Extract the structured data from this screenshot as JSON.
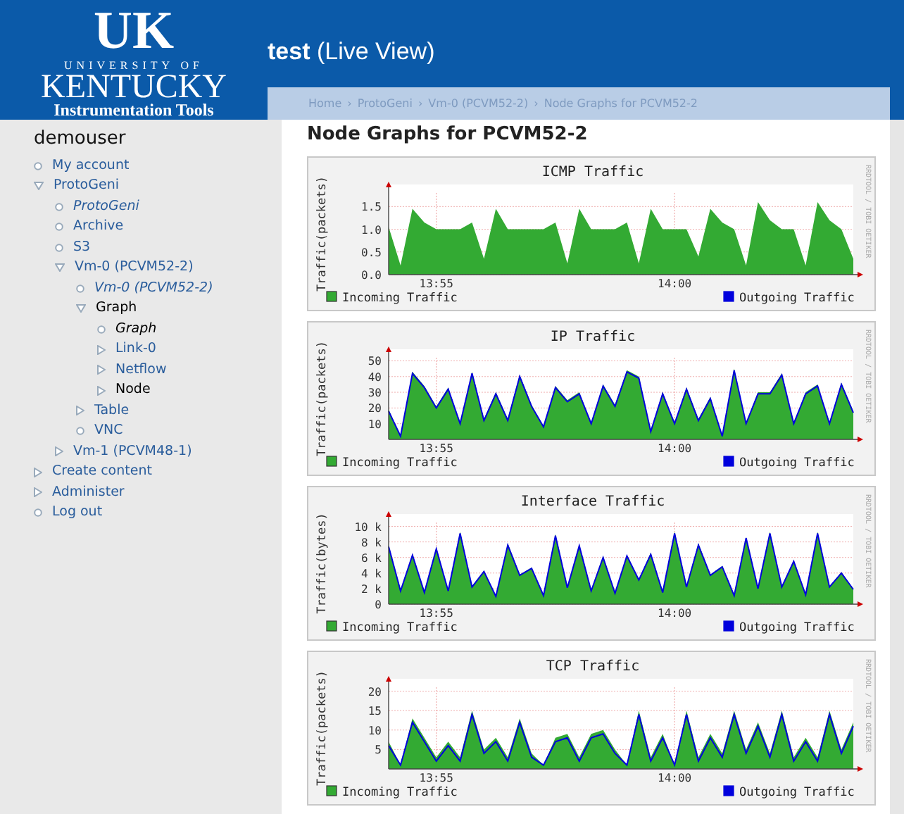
{
  "logo": {
    "mark": "UK",
    "line1": "UNIVERSITY OF",
    "line2": "KENTUCKY",
    "line3": "Instrumentation Tools"
  },
  "title": "**test** (Live View)",
  "breadcrumb": [
    {
      "label": "Home"
    },
    {
      "label": "ProtoGeni",
      "separator": "›"
    },
    {
      "label": "Vm-0 (PCVM52-2)",
      "separator": "›"
    },
    {
      "label": "Node Graphs for PCVM52-2",
      "separator": "›"
    }
  ],
  "sidebar": {
    "title": "demouser",
    "items": [
      {
        "label": "My account",
        "kind": "leaf",
        "italic": false,
        "active": false
      },
      {
        "label": "ProtoGeni",
        "kind": "expanded",
        "italic": false,
        "active": false,
        "children": [
          {
            "label": "ProtoGeni",
            "kind": "leaf",
            "italic": true,
            "active": false
          },
          {
            "label": "Archive",
            "kind": "leaf",
            "italic": false,
            "active": false
          },
          {
            "label": "S3",
            "kind": "leaf",
            "italic": false,
            "active": false
          },
          {
            "label": "Vm-0 (PCVM52-2)",
            "kind": "expanded",
            "italic": false,
            "active": false,
            "children": [
              {
                "label": "Vm-0 (PCVM52-2)",
                "kind": "leaf",
                "italic": true,
                "active": false
              },
              {
                "label": "Graph",
                "kind": "expanded",
                "italic": false,
                "active": true,
                "children": [
                  {
                    "label": "Graph",
                    "kind": "leaf",
                    "italic": true,
                    "active": true
                  },
                  {
                    "label": "Link-0",
                    "kind": "collapsed",
                    "italic": false,
                    "active": false
                  },
                  {
                    "label": "Netflow",
                    "kind": "collapsed",
                    "italic": false,
                    "active": false
                  },
                  {
                    "label": "Node",
                    "kind": "collapsed",
                    "italic": false,
                    "active": true
                  }
                ]
              },
              {
                "label": "Table",
                "kind": "collapsed",
                "italic": false,
                "active": false
              },
              {
                "label": "VNC",
                "kind": "leaf",
                "italic": false,
                "active": false
              }
            ]
          },
          {
            "label": "Vm-1 (PCVM48-1)",
            "kind": "collapsed",
            "italic": false,
            "active": false
          }
        ]
      },
      {
        "label": "Create content",
        "kind": "collapsed",
        "italic": false,
        "active": false
      },
      {
        "label": "Administer",
        "kind": "collapsed",
        "italic": false,
        "active": false
      },
      {
        "label": "Log out",
        "kind": "leaf",
        "italic": false,
        "active": false
      }
    ]
  },
  "heading": "Node Graphs for PCVM52-2",
  "graphs": [
    {
      "credit": "RRDTOOL / TOBI OETIKER",
      "chart_data": {
        "type": "area",
        "title": "ICMP Traffic",
        "grid": true,
        "legend": "bottom",
        "ylabel": "Traffic(packets)",
        "categories": [
          null,
          null,
          null,
          null,
          "13:55",
          null,
          null,
          null,
          null,
          null,
          null,
          null,
          null,
          null,
          null,
          null,
          null,
          null,
          null,
          null,
          null,
          null,
          null,
          null,
          "14:00",
          null,
          null,
          null,
          null,
          null,
          null,
          null,
          null,
          null,
          null,
          null,
          null,
          null,
          null,
          null
        ],
        "ylim": [
          0,
          1.8
        ],
        "yticks": [
          {
            "value": 0,
            "label": "0.0"
          },
          {
            "value": 0.5,
            "label": "0.5"
          },
          {
            "value": 1,
            "label": "1.0"
          },
          {
            "value": 1.5,
            "label": "1.5"
          }
        ],
        "series": [
          {
            "name": "Incoming Traffic",
            "color": "#33aa33",
            "values": [
              1.05,
              0.2,
              1.45,
              1.15,
              1,
              1,
              1,
              1.15,
              0.35,
              1.45,
              1,
              1,
              1,
              1,
              1.15,
              0.25,
              1.45,
              1,
              1,
              1,
              1.15,
              0.25,
              1.45,
              1,
              1,
              1,
              0.4,
              1.45,
              1.15,
              1,
              0.2,
              1.6,
              1.2,
              1,
              1,
              0.2,
              1.6,
              1.2,
              1,
              0.35
            ]
          },
          {
            "name": "Outgoing Traffic",
            "type": "line",
            "color": "#0000dd",
            "values": [
              null,
              null,
              null,
              null,
              null,
              null,
              null,
              null,
              null,
              null,
              null,
              null,
              null,
              null,
              null,
              null,
              null,
              null,
              null,
              null,
              null,
              null,
              null,
              null,
              null,
              null,
              null,
              null,
              null,
              null,
              null,
              null,
              null,
              null,
              null,
              null,
              null,
              null,
              null,
              null
            ]
          }
        ]
      }
    },
    {
      "credit": "RRDTOOL / TOBI OETIKER",
      "chart_data": {
        "type": "area",
        "title": "IP Traffic",
        "grid": true,
        "legend": "bottom",
        "ylabel": "Traffic(packets)",
        "categories": [
          null,
          null,
          null,
          null,
          "13:55",
          null,
          null,
          null,
          null,
          null,
          null,
          null,
          null,
          null,
          null,
          null,
          null,
          null,
          null,
          null,
          null,
          null,
          null,
          null,
          "14:00",
          null,
          null,
          null,
          null,
          null,
          null,
          null,
          null,
          null,
          null,
          null,
          null,
          null,
          null,
          null
        ],
        "ylim": [
          0,
          52
        ],
        "yticks": [
          10,
          20,
          30,
          40,
          50
        ],
        "series": [
          {
            "name": "Incoming Traffic",
            "color": "#33aa33",
            "values": [
              19,
              2,
              43,
              34,
              21,
              33,
              10,
              43,
              13,
              30,
              13,
              41,
              22,
              8,
              34,
              25,
              30,
              10,
              35,
              22,
              44,
              40,
              5,
              30,
              10,
              33,
              13,
              27,
              2,
              45,
              10,
              30,
              30,
              42,
              10,
              30,
              35,
              10,
              36,
              18
            ]
          },
          {
            "name": "Outgoing Traffic",
            "type": "line",
            "color": "#0000dd",
            "values": [
              18,
              2,
              42,
              33,
              20,
              32,
              10,
              42,
              12,
              29,
              12,
              40,
              21,
              8,
              33,
              24,
              29,
              10,
              34,
              21,
              43,
              39,
              5,
              29,
              10,
              32,
              12,
              26,
              2,
              44,
              10,
              29,
              29,
              41,
              10,
              29,
              34,
              10,
              35,
              17
            ]
          }
        ]
      }
    },
    {
      "credit": "RRDTOOL / TOBI OETIKER",
      "chart_data": {
        "type": "area",
        "title": "Interface Traffic",
        "grid": true,
        "legend": "bottom",
        "ylabel": "Traffic(bytes)",
        "categories": [
          null,
          null,
          null,
          null,
          "13:55",
          null,
          null,
          null,
          null,
          null,
          null,
          null,
          null,
          null,
          null,
          null,
          null,
          null,
          null,
          null,
          null,
          null,
          null,
          null,
          "14:00",
          null,
          null,
          null,
          null,
          null,
          null,
          null,
          null,
          null,
          null,
          null,
          null,
          null,
          null,
          null
        ],
        "ylim": [
          0,
          10500
        ],
        "yticks": [
          {
            "value": 0,
            "label": "0"
          },
          {
            "value": 2000,
            "label": "2 k"
          },
          {
            "value": 4000,
            "label": "4 k"
          },
          {
            "value": 6000,
            "label": "6 k"
          },
          {
            "value": 8000,
            "label": "8 k"
          },
          {
            "value": 10000,
            "label": "10 k"
          }
        ],
        "series": [
          {
            "name": "Incoming Traffic",
            "color": "#33aa33",
            "values": [
              7600,
              1800,
              6400,
              1600,
              7200,
              1800,
              9300,
              2300,
              4300,
              1000,
              7800,
              3800,
              4700,
              1200,
              9000,
              2200,
              7600,
              1800,
              6200,
              1500,
              6300,
              3200,
              6600,
              1600,
              9300,
              2300,
              7800,
              3800,
              4900,
              1200,
              8600,
              2100,
              9300,
              2300,
              5600,
              1300,
              9300,
              2300,
              4100,
              2000
            ]
          },
          {
            "name": "Outgoing Traffic",
            "type": "line",
            "color": "#0000dd",
            "values": [
              7400,
              1700,
              6300,
              1500,
              7100,
              1700,
              9100,
              2200,
              4200,
              1000,
              7600,
              3700,
              4600,
              1100,
              8800,
              2100,
              7500,
              1700,
              6000,
              1400,
              6200,
              3100,
              6400,
              1500,
              9100,
              2200,
              7600,
              3700,
              4800,
              1100,
              8500,
              2000,
              9100,
              2200,
              5500,
              1200,
              9100,
              2200,
              4000,
              1900
            ]
          }
        ]
      }
    },
    {
      "credit": "RRDTOOL / TOBI OETIKER",
      "chart_data": {
        "type": "area",
        "title": "TCP Traffic",
        "grid": true,
        "legend": "bottom",
        "ylabel": "Traffic(packets)",
        "categories": [
          null,
          null,
          null,
          null,
          "13:55",
          null,
          null,
          null,
          null,
          null,
          null,
          null,
          null,
          null,
          null,
          null,
          null,
          null,
          null,
          null,
          null,
          null,
          null,
          null,
          "14:00",
          null,
          null,
          null,
          null,
          null,
          null,
          null,
          null,
          null,
          null,
          null,
          null,
          null,
          null,
          null
        ],
        "ylim": [
          0,
          21
        ],
        "yticks": [
          5,
          10,
          15,
          20
        ],
        "series": [
          {
            "name": "Incoming Traffic",
            "color": "#33aa33",
            "values": [
              7,
              1,
              13,
              8,
              3,
              7,
              3,
              15,
              5,
              8,
              3,
              13,
              4,
              1,
              8,
              9,
              3,
              9,
              10,
              5,
              1,
              15,
              3,
              9,
              1,
              15,
              3,
              9,
              4,
              15,
              5,
              12,
              4,
              15,
              3,
              8,
              3,
              15,
              5,
              12
            ]
          },
          {
            "name": "Outgoing Traffic",
            "type": "line",
            "color": "#0000dd",
            "values": [
              6,
              1,
              12,
              7,
              2,
              6,
              2,
              14,
              4,
              7,
              2,
              12,
              3,
              1,
              7,
              8,
              2,
              8,
              9,
              4,
              1,
              14,
              2,
              8,
              1,
              14,
              2,
              8,
              3,
              14,
              4,
              11,
              3,
              14,
              2,
              7,
              2,
              14,
              4,
              11
            ]
          }
        ]
      }
    }
  ]
}
